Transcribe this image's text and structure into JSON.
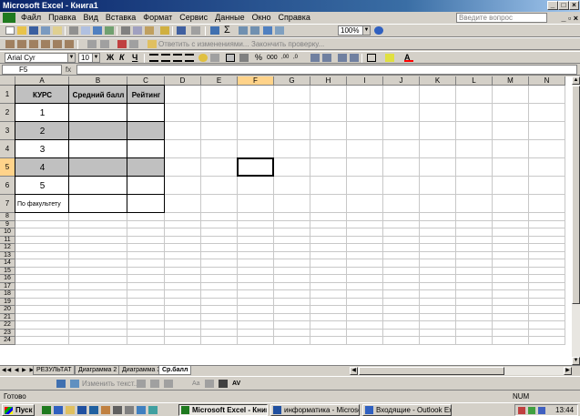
{
  "window": {
    "title": "Microsoft Excel - Книга1"
  },
  "menu": {
    "items": [
      "Файл",
      "Правка",
      "Вид",
      "Вставка",
      "Формат",
      "Сервис",
      "Данные",
      "Окно",
      "Справка"
    ],
    "help_placeholder": "Введите вопрос"
  },
  "toolbar1": {
    "zoom": "100%"
  },
  "toolbar2": {
    "reply_label": "Ответить с изменениями...",
    "end_review_label": "Закончить проверку..."
  },
  "toolbar3": {
    "font": "Arial Cyr",
    "size": "10"
  },
  "formula_bar": {
    "name_box": "F5",
    "fx": "fx",
    "value": ""
  },
  "sheet": {
    "columns": [
      "A",
      "B",
      "C",
      "D",
      "E",
      "F",
      "G",
      "H",
      "I",
      "J",
      "K",
      "L",
      "M",
      "N"
    ],
    "rows": [
      "1",
      "2",
      "3",
      "4",
      "5",
      "6",
      "7",
      "8",
      "9",
      "10",
      "11",
      "12",
      "13",
      "14",
      "15",
      "16",
      "17",
      "18",
      "19",
      "20",
      "21",
      "22",
      "23",
      "24"
    ],
    "selected_cell": "F5",
    "table": {
      "headers": [
        "КУРС",
        "Средний балл",
        "Рейтинг"
      ],
      "rows": [
        [
          "1",
          "",
          ""
        ],
        [
          "2",
          "",
          ""
        ],
        [
          "3",
          "",
          ""
        ],
        [
          "4",
          "",
          ""
        ],
        [
          "5",
          "",
          ""
        ],
        [
          "По факультету",
          "",
          ""
        ]
      ]
    }
  },
  "sheet_tabs": [
    "РЕЗУЛЬТАТ",
    "Диаграмма 2",
    "Диаграмма 3",
    "Ср.балл"
  ],
  "active_tab": "Ср.балл",
  "drawbar": {
    "text_label": "Изменить текст..."
  },
  "status": {
    "left": "Готово",
    "num": "NUM"
  },
  "taskbar": {
    "start": "Пуск",
    "tasks": [
      "Microsoft Excel - Книг...",
      "информатика - Microsoft ...",
      "Входящие - Outlook Expre..."
    ],
    "clock": "13:44"
  },
  "colors": {
    "title_start": "#0a246a",
    "title_end": "#a6caf0",
    "gray_fill": "#c0c0c0",
    "active_header": "#ffd38a"
  }
}
